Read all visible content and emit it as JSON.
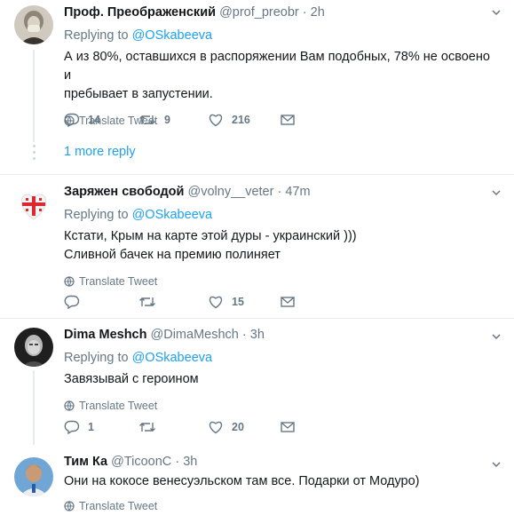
{
  "tweets": [
    {
      "name": "Проф. Преображенский",
      "handle": "@prof_preobr",
      "dot": "·",
      "time": "2h",
      "replying_prefix": "Replying to",
      "replying_to": "@OSkabeeva",
      "text_lines": [
        "А из 80%, оставшихся в распоряжении Вам подобных, 78% не освоено и",
        "пребывает в запустении."
      ],
      "translate": "Translate Tweet",
      "replies": "14",
      "retweets": "9",
      "likes": "216",
      "more_replies": "1 more reply"
    },
    {
      "name": "Заряжен свободой",
      "handle": "@volny__veter",
      "dot": "·",
      "time": "47m",
      "replying_prefix": "Replying to",
      "replying_to": "@OSkabeeva",
      "text_lines": [
        "Кстати, Крым на карте этой дуры - украинский )))",
        "Сливной бачек на премию полиняет"
      ],
      "translate": "Translate Tweet",
      "replies": "",
      "retweets": "",
      "likes": "15"
    },
    {
      "name": "Dima Meshch",
      "handle": "@DimaMeshch",
      "dot": "·",
      "time": "3h",
      "replying_prefix": "Replying to",
      "replying_to": "@OSkabeeva",
      "text_lines": [
        "Завязывай с героином"
      ],
      "translate": "Translate Tweet",
      "replies": "1",
      "retweets": "",
      "likes": "20"
    },
    {
      "name": "Тим Ка",
      "handle": "@TicoonC",
      "dot": "·",
      "time": "3h",
      "text_lines": [
        "Они на кокосе венесуэльском там все. Подарки от Модуро)"
      ],
      "translate": "Translate Tweet"
    }
  ],
  "icons": {
    "reply": "reply-icon",
    "retweet": "retweet-icon",
    "like": "heart-icon",
    "dm": "envelope-icon",
    "translate": "globe-icon",
    "caret": "chevron-down-icon"
  },
  "colors": {
    "accent": "#1da1f2",
    "muted": "#657786",
    "text": "#14171a",
    "border": "#e6ecf0"
  }
}
